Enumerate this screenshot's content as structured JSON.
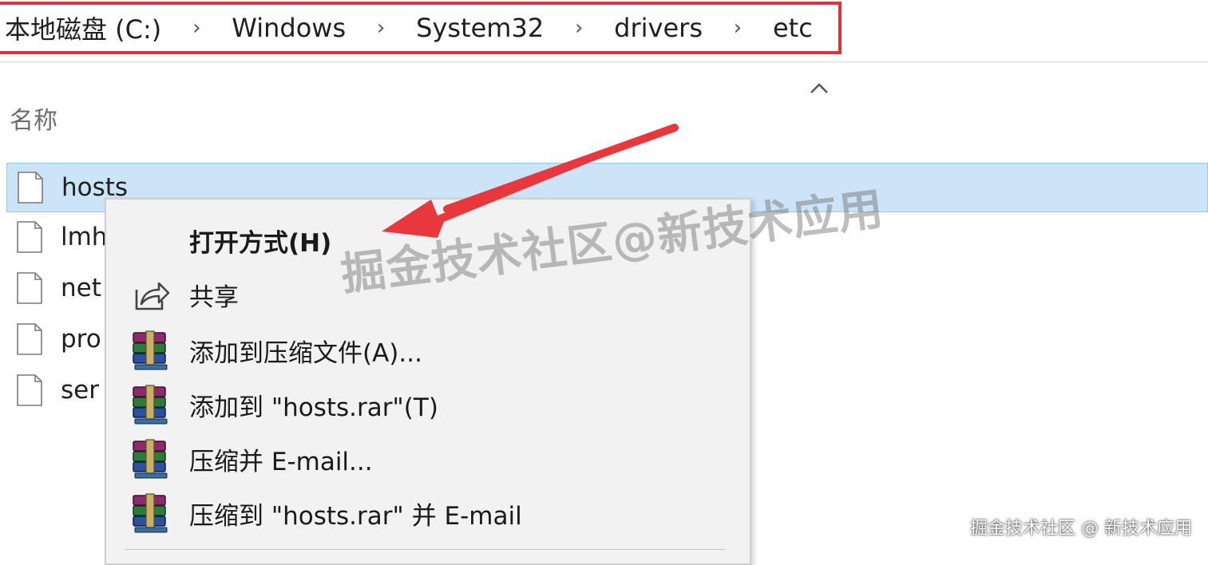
{
  "breadcrumb": {
    "items": [
      "本地磁盘 (C:)",
      "Windows",
      "System32",
      "drivers",
      "etc"
    ],
    "separator": "›",
    "highlight_color": "#e0303a"
  },
  "file_list": {
    "column_header": "名称",
    "files": [
      {
        "name": "hosts",
        "selected": true
      },
      {
        "name": "lmh"
      },
      {
        "name": "net"
      },
      {
        "name": "pro"
      },
      {
        "name": "ser"
      }
    ]
  },
  "context_menu": {
    "items": [
      {
        "label": "打开方式(H)",
        "icon": "none",
        "bold": true
      },
      {
        "label": "共享",
        "icon": "share-icon"
      },
      {
        "label": "添加到压缩文件(A)...",
        "icon": "winrar-icon"
      },
      {
        "label": "添加到 \"hosts.rar\"(T)",
        "icon": "winrar-icon"
      },
      {
        "label": "压缩并 E-mail...",
        "icon": "winrar-icon"
      },
      {
        "label": "压缩到 \"hosts.rar\" 并 E-mail",
        "icon": "winrar-icon"
      }
    ]
  },
  "annotation": {
    "arrow_color": "#e8383d"
  },
  "watermark": {
    "center": "掘金技术社区@新技术应用",
    "corner": "掘金技术社区 @ 新技术应用"
  },
  "colors": {
    "selection": "#cce4f7",
    "menu_background": "#f2f2f2"
  }
}
